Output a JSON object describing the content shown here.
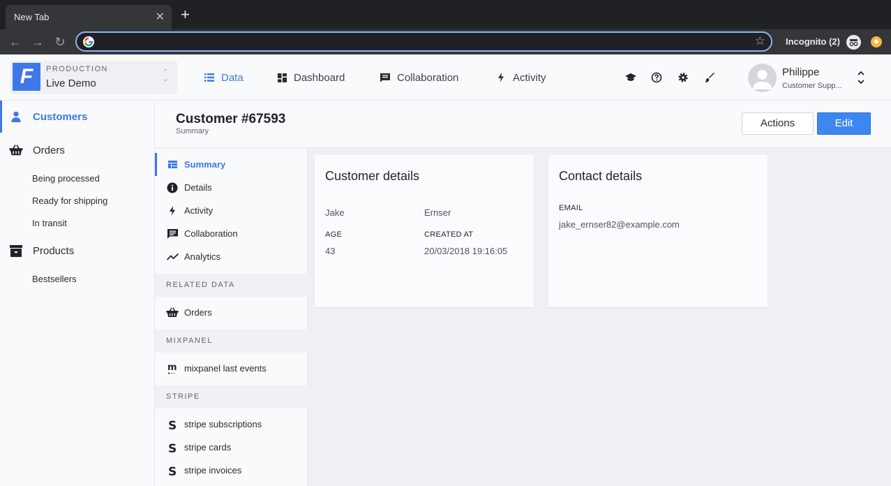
{
  "browser": {
    "tab_title": "New Tab",
    "incognito_label": "Incognito (2)"
  },
  "app": {
    "project_env": "PRODUCTION",
    "project_name": "Live Demo",
    "nav": [
      {
        "label": "Data",
        "icon": "list-icon",
        "active": true
      },
      {
        "label": "Dashboard",
        "icon": "dashboard-grid-icon",
        "active": false
      },
      {
        "label": "Collaboration",
        "icon": "chat-icon",
        "active": false
      },
      {
        "label": "Activity",
        "icon": "bolt-icon",
        "active": false
      }
    ],
    "user": {
      "name": "Philippe",
      "role": "Customer Supp..."
    }
  },
  "sidebar": {
    "items": [
      {
        "label": "Customers",
        "icon": "person-icon",
        "active": true
      },
      {
        "label": "Orders",
        "icon": "basket-icon",
        "active": false
      },
      {
        "label": "Products",
        "icon": "archive-box-icon",
        "active": false
      }
    ],
    "orders_sub": [
      "Being processed",
      "Ready for shipping",
      "In transit"
    ],
    "products_sub": [
      "Bestsellers"
    ]
  },
  "page": {
    "title": "Customer #67593",
    "subtitle": "Summary",
    "actions_label": "Actions",
    "edit_label": "Edit"
  },
  "subnav": {
    "items": [
      {
        "label": "Summary",
        "icon": "summary-icon",
        "active": true
      },
      {
        "label": "Details",
        "icon": "info-icon",
        "active": false
      },
      {
        "label": "Activity",
        "icon": "bolt-icon",
        "active": false
      },
      {
        "label": "Collaboration",
        "icon": "chat-icon",
        "active": false
      },
      {
        "label": "Analytics",
        "icon": "trend-line-icon",
        "active": false
      }
    ],
    "sections": [
      {
        "title": "RELATED DATA",
        "items": [
          {
            "label": "Orders",
            "icon": "basket-icon"
          }
        ]
      },
      {
        "title": "MIXPANEL",
        "items": [
          {
            "label": "mixpanel last events",
            "icon": "mixpanel-logo-icon"
          }
        ]
      },
      {
        "title": "STRIPE",
        "items": [
          {
            "label": "stripe subscriptions",
            "icon": "stripe-logo-icon"
          },
          {
            "label": "stripe cards",
            "icon": "stripe-logo-icon"
          },
          {
            "label": "stripe invoices",
            "icon": "stripe-logo-icon"
          }
        ]
      }
    ]
  },
  "customer_details": {
    "title": "Customer details",
    "first_name": "Jake",
    "last_name": "Ernser",
    "age_label": "AGE",
    "age": "43",
    "created_label": "CREATED AT",
    "created_at": "20/03/2018 19:16:05"
  },
  "contact_details": {
    "title": "Contact details",
    "email_label": "EMAIL",
    "email": "jake_ernser82@example.com"
  },
  "colors": {
    "accent": "#3e78e6",
    "edit_button": "#3e86f2"
  }
}
